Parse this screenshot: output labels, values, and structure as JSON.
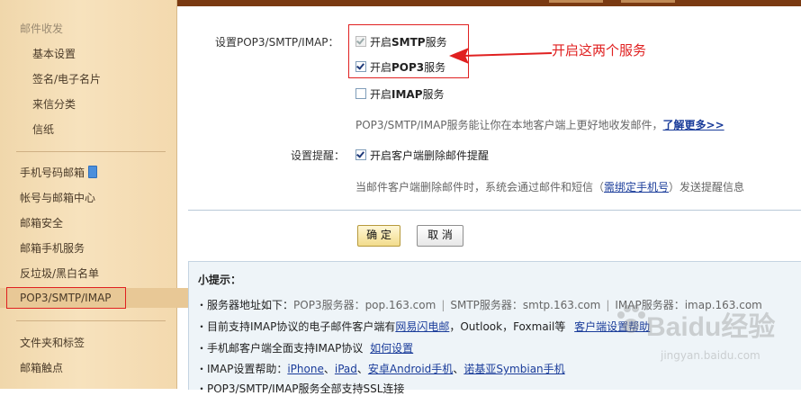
{
  "sidebar": {
    "group_mail": "邮件收发",
    "items_mail": [
      "基本设置",
      "签名/电子名片",
      "来信分类",
      "信纸"
    ],
    "items_account": [
      "手机号码邮箱",
      "帐号与邮箱中心",
      "邮箱安全",
      "邮箱手机服务",
      "反垃圾/黑白名单",
      "POP3/SMTP/IMAP"
    ],
    "items_more": [
      "文件夹和标签",
      "邮箱触点"
    ],
    "active": "POP3/SMTP/IMAP"
  },
  "settings": {
    "pop_label": "设置POP3/SMTP/IMAP：",
    "smtp": {
      "prefix": "开启",
      "proto": "SMTP",
      "suffix": "服务",
      "checked": true,
      "disabled": true
    },
    "pop3": {
      "prefix": "开启",
      "proto": "POP3",
      "suffix": "服务",
      "checked": true
    },
    "imap": {
      "prefix": "开启",
      "proto": "IMAP",
      "suffix": "服务",
      "checked": false
    },
    "pop_desc": "POP3/SMTP/IMAP服务能让你在本地客户端上更好地收发邮件，",
    "pop_desc_link": "了解更多>>",
    "reminder_label": "设置提醒：",
    "reminder_option": "开启客户端删除邮件提醒",
    "reminder_checked": true,
    "reminder_desc_before": "当邮件客户端删除邮件时，系统会通过邮件和短信（",
    "reminder_desc_link": "需绑定手机号",
    "reminder_desc_after": "）发送提醒信息"
  },
  "annotation": {
    "text": "开启这两个服务",
    "color": "#e02020"
  },
  "buttons": {
    "ok": "确 定",
    "cancel": "取 消"
  },
  "tips": {
    "title": "小提示：",
    "servers_label": "・服务器地址如下：",
    "pop3_server": "POP3服务器：pop.163.com",
    "smtp_server": "SMTP服务器：smtp.163.com",
    "imap_server": "IMAP服务器：imap.163.com",
    "sep": "|",
    "clients_before": "・目前支持IMAP协议的电子邮件客户端有",
    "clients_link": "网易闪电邮",
    "clients_after": "，Outlook，Foxmail等",
    "clients_help_link": "客户端设置帮助",
    "mobile_text": "・手机邮客户端全面支持IMAP协议",
    "mobile_link": "如何设置",
    "imap_help_label": "・IMAP设置帮助：",
    "imap_help_links": [
      "iPhone",
      "iPad",
      "安卓Android手机",
      "诺基亚Symbian手机"
    ],
    "imap_help_sep": "、",
    "ssl_text": "・POP3/SMTP/IMAP服务全部支持SSL连接"
  },
  "watermark": {
    "text": "Baidu经验",
    "url": "jingyan.baidu.com"
  }
}
